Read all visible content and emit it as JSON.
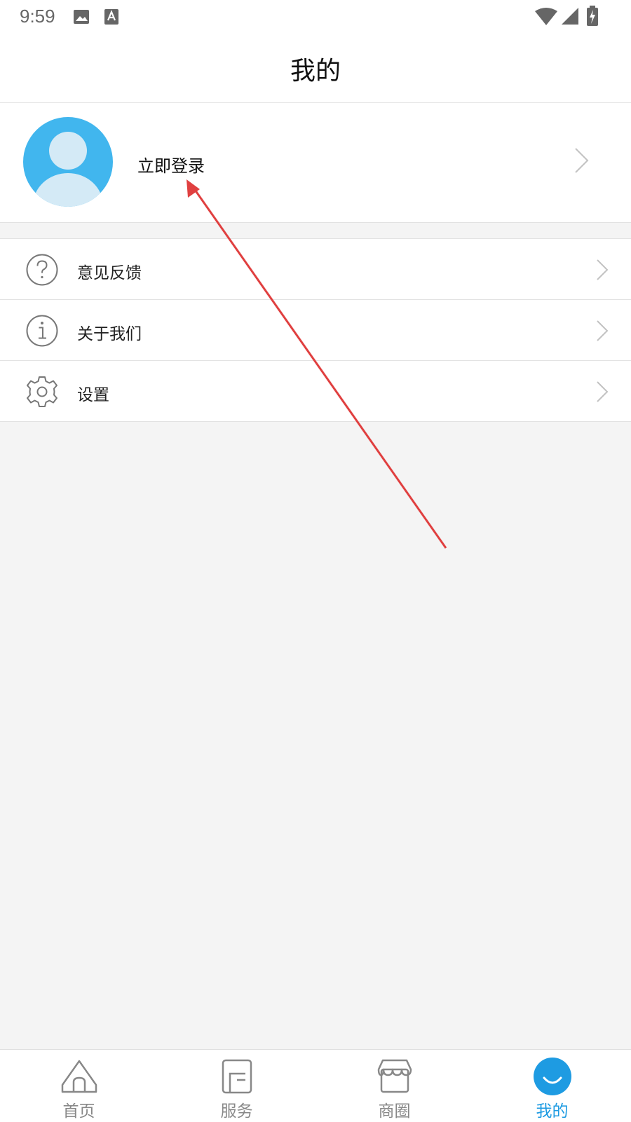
{
  "status_bar": {
    "time": "9:59",
    "icons": [
      "image-notification-icon",
      "text-notification-icon",
      "wifi-icon",
      "cellular-signal-icon",
      "battery-charging-icon"
    ]
  },
  "header": {
    "title": "我的"
  },
  "profile": {
    "login_label": "立即登录",
    "avatar_color": "#41b6ee"
  },
  "menu": {
    "items": [
      {
        "label": "意见反馈",
        "icon": "help-circle-icon"
      },
      {
        "label": "关于我们",
        "icon": "info-circle-icon"
      },
      {
        "label": "设置",
        "icon": "gear-icon"
      }
    ]
  },
  "tabbar": {
    "active_color": "#1e9be2",
    "inactive_color": "#888888",
    "tabs": [
      {
        "label": "首页",
        "icon": "home-icon",
        "active": false
      },
      {
        "label": "服务",
        "icon": "service-icon",
        "active": false
      },
      {
        "label": "商圈",
        "icon": "store-icon",
        "active": false
      },
      {
        "label": "我的",
        "icon": "profile-smile-icon",
        "active": true
      }
    ]
  },
  "annotation": {
    "color": "#e04040",
    "type": "arrow"
  }
}
